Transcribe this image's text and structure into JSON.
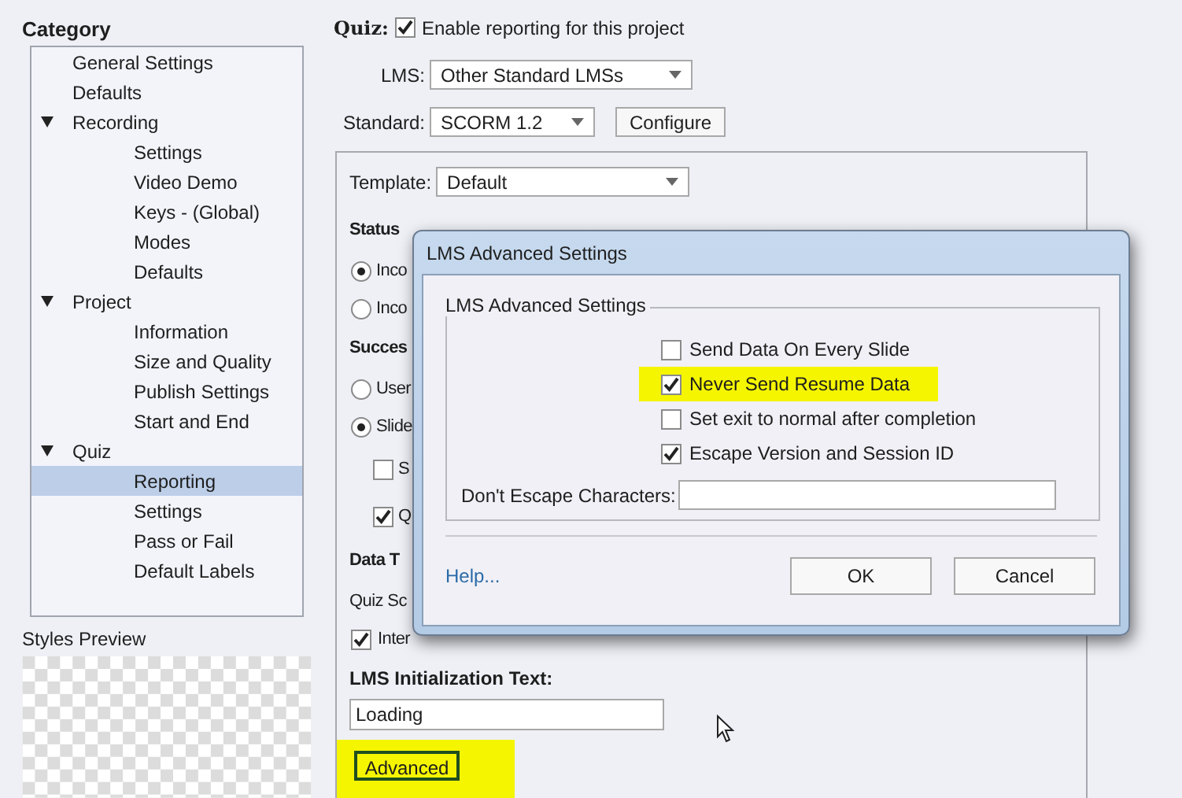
{
  "category": {
    "title": "Category",
    "tree": [
      {
        "label": "General Settings",
        "selected": false
      },
      {
        "label": "Defaults",
        "selected": false
      },
      {
        "label": "Recording",
        "selected": false,
        "expanded": true,
        "children": [
          {
            "label": "Settings",
            "selected": false
          },
          {
            "label": "Video Demo",
            "selected": false
          },
          {
            "label": "Keys - (Global)",
            "selected": false
          },
          {
            "label": "Modes",
            "selected": false
          },
          {
            "label": "Defaults",
            "selected": false
          }
        ]
      },
      {
        "label": "Project",
        "selected": false,
        "expanded": true,
        "children": [
          {
            "label": "Information",
            "selected": false
          },
          {
            "label": "Size and Quality",
            "selected": false
          },
          {
            "label": "Publish Settings",
            "selected": false
          },
          {
            "label": "Start and End",
            "selected": false
          }
        ]
      },
      {
        "label": "Quiz",
        "selected": false,
        "expanded": true,
        "children": [
          {
            "label": "Reporting",
            "selected": true
          },
          {
            "label": "Settings",
            "selected": false
          },
          {
            "label": "Pass or Fail",
            "selected": false
          },
          {
            "label": "Default Labels",
            "selected": false
          }
        ]
      }
    ]
  },
  "styles_preview": {
    "label": "Styles Preview"
  },
  "quiz": {
    "label": "Quiz:",
    "enable_reporting": {
      "label": "Enable reporting for this project",
      "checked": true
    },
    "lms": {
      "label": "LMS:",
      "value": "Other Standard LMSs"
    },
    "standard": {
      "label": "Standard:",
      "value": "SCORM 1.2"
    },
    "configure_button": "Configure",
    "template": {
      "label": "Template:",
      "value": "Default"
    },
    "items": [
      {
        "kind": "heading",
        "text": "Status"
      },
      {
        "kind": "radio",
        "text": "Inco",
        "selected": true
      },
      {
        "kind": "radio",
        "text": "Inco",
        "selected": false
      },
      {
        "kind": "heading",
        "text": "Succes"
      },
      {
        "kind": "radio",
        "text": "User",
        "selected": false
      },
      {
        "kind": "radio",
        "text": "Slide",
        "selected": true
      },
      {
        "kind": "subcheckbox",
        "text": "S",
        "checked": false
      },
      {
        "kind": "subcheckbox",
        "text": "Q",
        "checked": true
      },
      {
        "kind": "heading",
        "text": "Data T"
      },
      {
        "kind": "text",
        "text": "Quiz Sc"
      },
      {
        "kind": "checkbox",
        "text": "Inter",
        "checked": true
      }
    ],
    "init_text": {
      "label": "LMS Initialization Text:",
      "value": "Loading"
    },
    "advanced_button": {
      "label": "Advanced",
      "highlighted": true
    }
  },
  "dialog": {
    "title": "LMS Advanced Settings",
    "group_title": "LMS Advanced Settings",
    "options": [
      {
        "label": "Send Data On Every Slide",
        "checked": false,
        "highlighted": false
      },
      {
        "label": "Never Send Resume Data",
        "checked": true,
        "highlighted": true
      },
      {
        "label": "Set exit to normal after completion",
        "checked": false,
        "highlighted": false
      },
      {
        "label": "Escape Version and Session ID",
        "checked": true,
        "highlighted": false
      }
    ],
    "escape_field": {
      "label": "Don't Escape Characters:"
    },
    "help_link": "Help...",
    "buttons": [
      "OK",
      "Cancel"
    ]
  }
}
